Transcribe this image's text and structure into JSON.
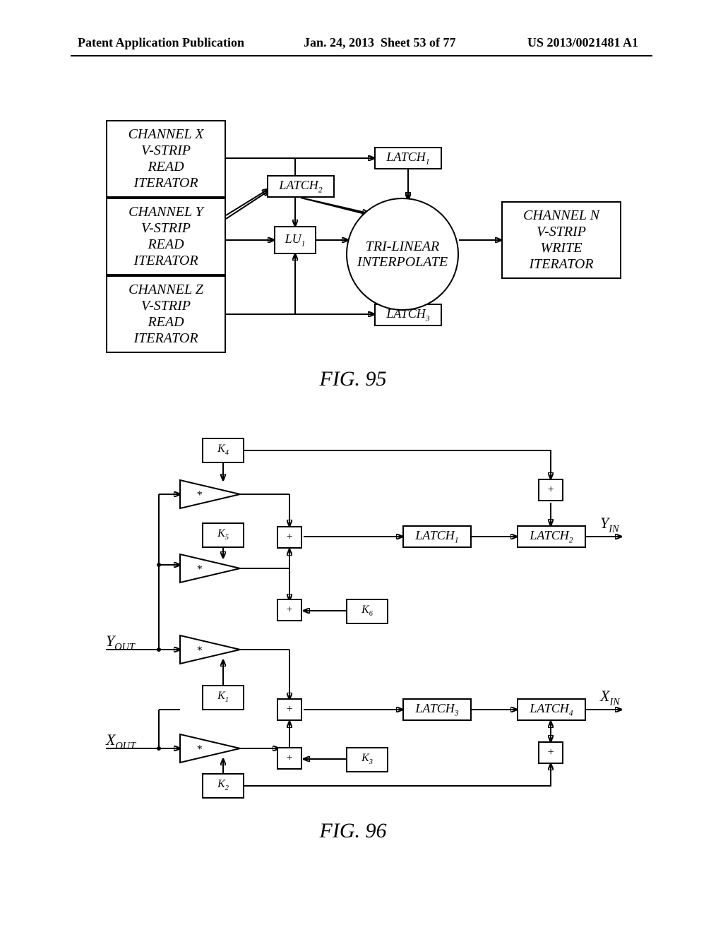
{
  "header": {
    "left": "Patent Application Publication",
    "mid_date": "Jan. 24, 2013",
    "mid_sheet": "Sheet 53 of 77",
    "right": "US 2013/0021481 A1"
  },
  "fig95": {
    "caption": "FIG. 95",
    "chanX": "CHANNEL X\nV-STRIP\nREAD\nITERATOR",
    "chanY": "CHANNEL Y\nV-STRIP\nREAD\nITERATOR",
    "chanZ": "CHANNEL Z\nV-STRIP\nREAD\nITERATOR",
    "lu1": "LU",
    "lu1_sub": "1",
    "interp": "TRI-LINEAR\nINTERPOLATE",
    "latch1": "LATCH",
    "latch1_sub": "1",
    "latch2": "LATCH",
    "latch2_sub": "2",
    "latch3": "LATCH",
    "latch3_sub": "3",
    "chanN": "CHANNEL N\nV-STRIP\nWRITE\nITERATOR"
  },
  "fig96": {
    "caption": "FIG. 96",
    "k1": "K",
    "k1_sub": "1",
    "k2": "K",
    "k2_sub": "2",
    "k3": "K",
    "k3_sub": "3",
    "k4": "K",
    "k4_sub": "4",
    "k5": "K",
    "k5_sub": "5",
    "k6": "K",
    "k6_sub": "6",
    "latch1": "LATCH",
    "latch1_sub": "1",
    "latch2": "LATCH",
    "latch2_sub": "2",
    "latch3": "LATCH",
    "latch3_sub": "3",
    "latch4": "LATCH",
    "latch4_sub": "4",
    "mul": "*",
    "add": "+",
    "yout": "Y",
    "yout_sub": "OUT",
    "xout": "X",
    "xout_sub": "OUT",
    "yin": "Y",
    "yin_sub": "IN",
    "xin": "X",
    "xin_sub": "IN"
  }
}
